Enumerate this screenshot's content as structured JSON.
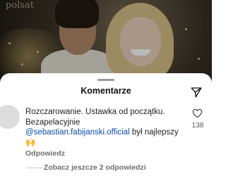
{
  "video": {
    "brand_text": "polsat"
  },
  "sheet": {
    "title": "Komentarze",
    "share_icon": "send-icon"
  },
  "comments": [
    {
      "text_line1": "Rozczarowanie. Ustawka od początku.",
      "text_line2": "Bezapelacyjnie",
      "mention": "@sebastian.fabijanski.official",
      "text_after_mention": " był najlepszy",
      "emoji": "🙌",
      "likes": "138",
      "like_icon": "heart-icon",
      "reply_label": "Odpowiedz",
      "view_more_label": "Zobacz jeszcze 2 odpowiedzi"
    }
  ],
  "colors": {
    "mention": "#0a4ea8",
    "secondary_text": "#6e6e6e"
  }
}
